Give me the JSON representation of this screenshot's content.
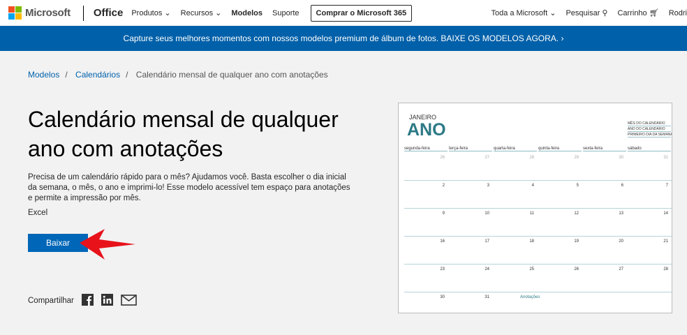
{
  "header": {
    "brand": "Microsoft",
    "product": "Office",
    "nav": [
      "Produtos ⌄",
      "Recursos ⌄",
      "Modelos",
      "Suporte"
    ],
    "buy": "Comprar o Microsoft 365",
    "all_ms": "Toda a Microsoft ⌄",
    "search": "Pesquisar",
    "cart": "Carrinho",
    "user": "Rodri"
  },
  "banner": "Capture seus melhores momentos com nossos modelos premium de álbum de fotos.  BAIXE OS MODELOS AGORA. ›",
  "breadcrumb": [
    "Modelos",
    "Calendários",
    "Calendário mensal de qualquer ano com anotações"
  ],
  "title": "Calendário mensal de qualquer ano com anotações",
  "description": "Precisa de um calendário rápido para o mês? Ajudamos você. Basta escolher o dia inicial da semana, o mês, o ano e imprimi-lo! Esse modelo acessível tem espaço para anotações e permite a impressão por mês.",
  "file_type": "Excel",
  "download": "Baixar",
  "share": "Compartilhar",
  "preview": {
    "month": "JANEIRO",
    "year": "ANO",
    "meta": [
      "MÊS DO CALENDÁRIO",
      "ANO DO CALENDÁRIO",
      "PRIMEIRO DIA DA SEMANA"
    ],
    "weekdays": [
      "segunda-feira",
      "terça-feira",
      "quarta-feira",
      "quinta-feira",
      "sexta-feira",
      "sábado"
    ],
    "weeks": [
      [
        "26",
        "27",
        "28",
        "29",
        "30",
        "31"
      ],
      [
        "2",
        "3",
        "4",
        "5",
        "6",
        "7"
      ],
      [
        "9",
        "10",
        "11",
        "12",
        "13",
        "14"
      ],
      [
        "16",
        "17",
        "18",
        "19",
        "20",
        "21"
      ],
      [
        "23",
        "24",
        "25",
        "26",
        "27",
        "28"
      ],
      [
        "30",
        "31"
      ]
    ],
    "notes": "Anotações"
  },
  "colors": {
    "accent": "#0067b8",
    "banner": "#0060a9",
    "calendar": "#2c7a86"
  }
}
